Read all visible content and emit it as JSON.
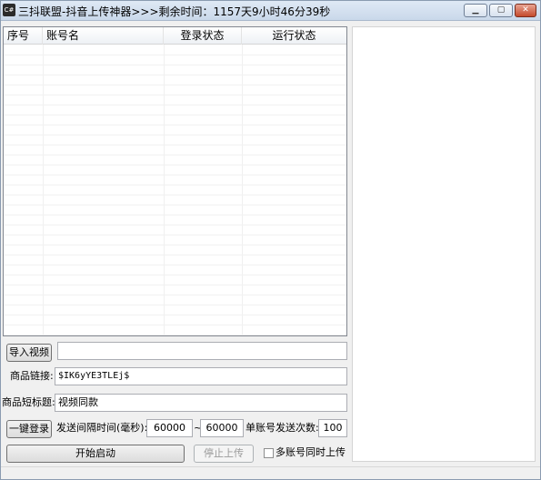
{
  "window": {
    "app_icon": "C#",
    "title": "三抖联盟-抖音上传神器>>>剩余时间：1157天9小时46分39秒",
    "minimize_icon": "minimize-icon",
    "maximize_icon": "maximize-icon",
    "close_icon": "close-icon"
  },
  "grid": {
    "columns": [
      "序号",
      "账号名",
      "登录状态",
      "运行状态"
    ],
    "rows": []
  },
  "form": {
    "import_video_label": "导入视频",
    "video_path_value": "",
    "product_link_label": "商品链接:",
    "product_link_value": "$IK6yYE3TLEj$",
    "product_title_label": "商品短标题:",
    "product_title_value": "视频同款",
    "login_button_label": "一键登录",
    "interval_label": "发送间隔时间(毫秒):",
    "interval_min": "60000",
    "interval_sep": "~",
    "interval_max": "60000",
    "send_count_label": "单账号发送次数:",
    "send_count_value": "100",
    "start_button_label": "开始启动",
    "stop_button_label": "停止上传",
    "multi_account_label": "多账号同时上传",
    "multi_account_checked": false
  }
}
